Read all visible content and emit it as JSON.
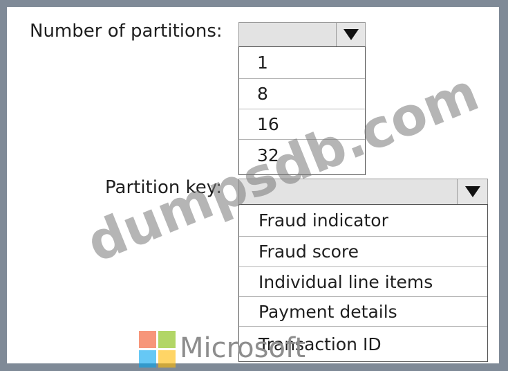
{
  "partitions": {
    "label": "Number of partitions:",
    "options": [
      "1",
      "8",
      "16",
      "32"
    ]
  },
  "partition_key": {
    "label": "Partition key:",
    "options": [
      "Fraud indicator",
      "Fraud score",
      "Individual line items",
      "Payment details",
      "Transaction ID"
    ]
  },
  "watermark": "dumpsdb.com",
  "brand": {
    "name": "Microsoft",
    "logo_colors": [
      "#f25022",
      "#7fba00",
      "#00a4ef",
      "#ffb900"
    ]
  },
  "colors": {
    "frame": "#7f8a97",
    "dropdown_bg": "#e3e3e3"
  }
}
